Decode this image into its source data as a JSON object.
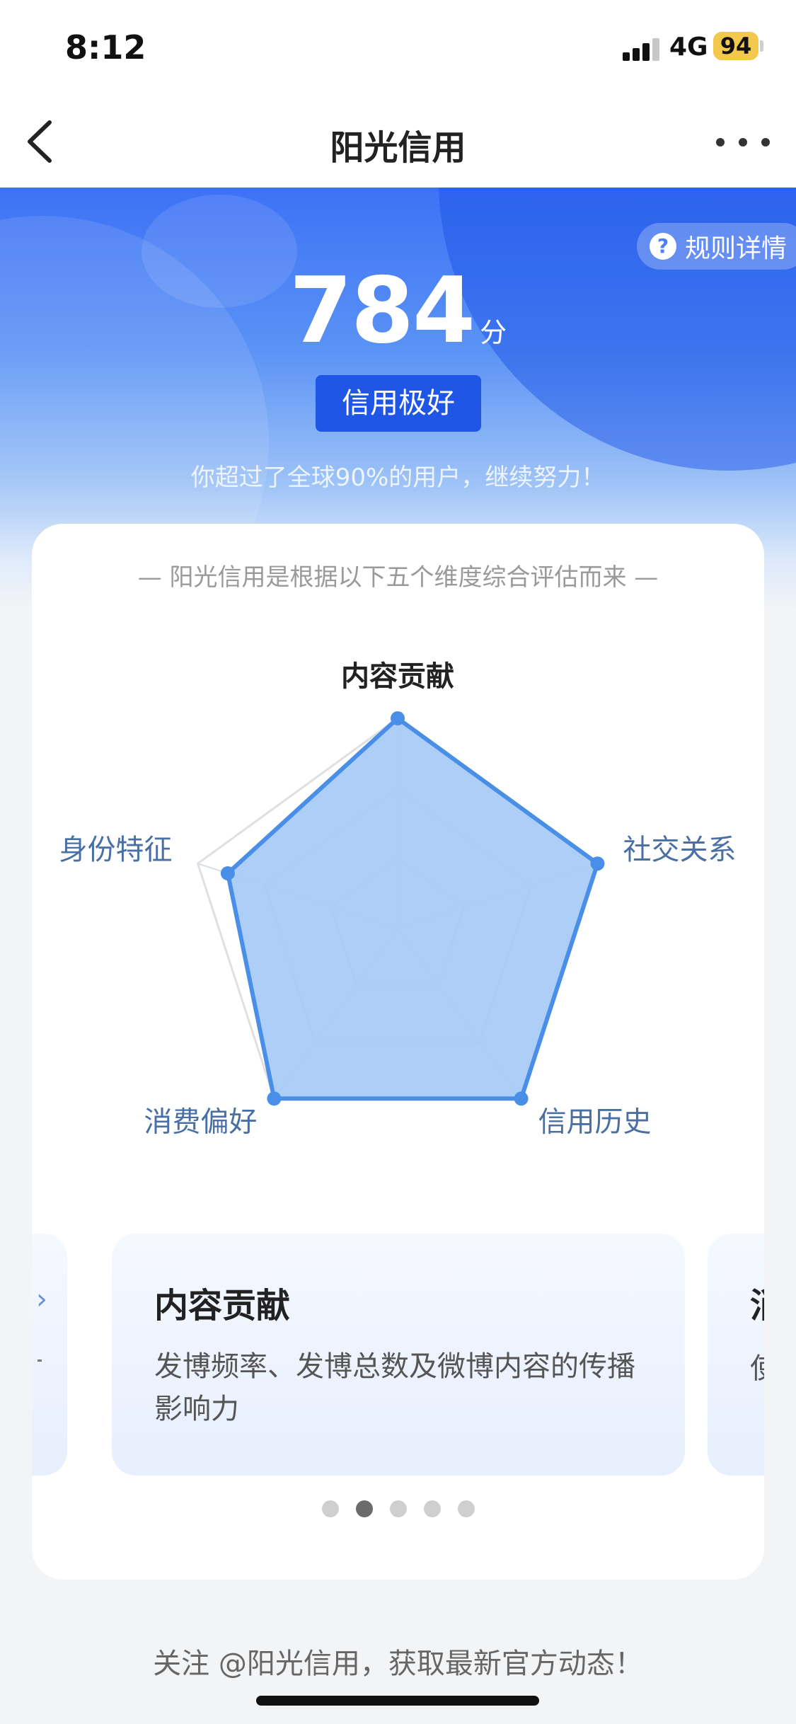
{
  "status_bar": {
    "time": "8:12",
    "network": "4G",
    "battery": "94"
  },
  "nav": {
    "title": "阳光信用"
  },
  "hero": {
    "rules_link": "规则详情",
    "score": "784",
    "score_unit": "分",
    "level": "信用极好",
    "rank_text": "你超过了全球90%的用户，继续努力！"
  },
  "card": {
    "intro": "— 阳光信用是根据以下五个维度综合评估而来 —"
  },
  "chart_data": {
    "type": "radar",
    "axes": [
      "内容贡献",
      "社交关系",
      "信用历史",
      "消费偏好",
      "身份特征"
    ],
    "values": [
      1.0,
      1.0,
      1.0,
      1.0,
      0.85
    ],
    "range": [
      0,
      1
    ],
    "colors": {
      "fill": "#a9cbf5",
      "stroke": "#4a8fe7",
      "grid": "#d6dde8",
      "label": "#4a6fa5",
      "label_highlight": "#222222"
    },
    "highlight_axis": "内容贡献"
  },
  "carousel": {
    "left_partial": {
      "glyph": "›",
      "dot": "·"
    },
    "current": {
      "title": "内容贡献",
      "description": "发博频率、发博总数及微博内容的传播影响力"
    },
    "right_partial": {
      "title": "消",
      "desc": "使"
    },
    "page_count": 5,
    "active_index": 1
  },
  "footer": {
    "text": "关注 @阳光信用，获取最新官方动态！"
  }
}
